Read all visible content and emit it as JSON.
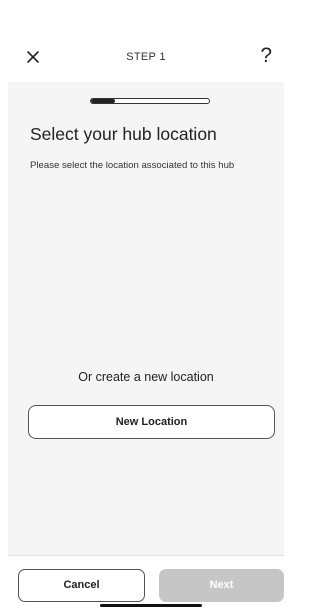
{
  "header": {
    "step_title": "STEP 1",
    "close_icon": "close-icon",
    "help_label": "?"
  },
  "progress": {
    "value_fraction": 0.2
  },
  "main": {
    "title": "Select your hub location",
    "subtitle": "Please select the location associated to this hub",
    "or_create_text": "Or create a new location",
    "new_location_label": "New Location"
  },
  "footer": {
    "cancel_label": "Cancel",
    "next_label": "Next",
    "next_disabled": true
  },
  "colors": {
    "background": "#f5f5f5",
    "next_disabled": "#c6c6c6",
    "text": "#222222"
  }
}
